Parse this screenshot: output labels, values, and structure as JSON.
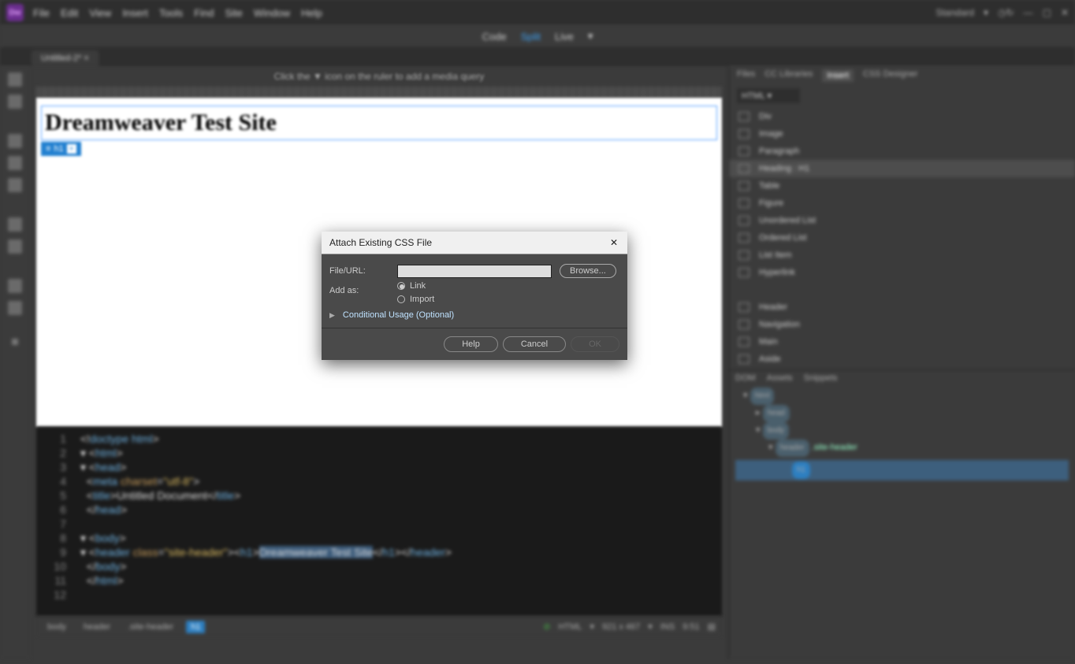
{
  "menubar": [
    "File",
    "Edit",
    "View",
    "Insert",
    "Tools",
    "Find",
    "Site",
    "Window",
    "Help"
  ],
  "workspace": "Standard",
  "view_tabs": {
    "code": "Code",
    "split": "Split",
    "live": "Live"
  },
  "doc_tab": "Untitled-2*",
  "hint": "Click the ▼ icon on the ruler to add a media query",
  "design": {
    "h1": "Dreamweaver Test Site",
    "chip": "h1",
    "plus": "+"
  },
  "code_lines": [
    {
      "n": "1",
      "raw": "<!doctype html>"
    },
    {
      "n": "2",
      "raw": "<html>"
    },
    {
      "n": "3",
      "raw": "<head>"
    },
    {
      "n": "4",
      "raw": "<meta charset=\"utf-8\">"
    },
    {
      "n": "5",
      "raw": "<title>Untitled Document</title>"
    },
    {
      "n": "6",
      "raw": "</head>"
    },
    {
      "n": "7",
      "raw": ""
    },
    {
      "n": "8",
      "raw": "<body>"
    },
    {
      "n": "9",
      "raw": "<header class=\"site-header\"><h1>Dreamweaver Test Site</h1></header>"
    },
    {
      "n": "10",
      "raw": "</body>"
    },
    {
      "n": "11",
      "raw": "</html>"
    },
    {
      "n": "12",
      "raw": ""
    }
  ],
  "status": {
    "breadcrumbs": [
      "body",
      "header",
      ".site-header",
      "h1"
    ],
    "doctype": "HTML",
    "dims": "921 x 467",
    "ins": "INS",
    "pos": "9:51"
  },
  "right": {
    "tabs": [
      "Files",
      "CC Libraries",
      "Insert",
      "CSS Designer"
    ],
    "active_tab": "Insert",
    "dd": "HTML",
    "items": [
      "Div",
      "Image",
      "Paragraph",
      "Heading : H1",
      "Table",
      "Figure",
      "Unordered List",
      "Ordered List",
      "List Item",
      "Hyperlink"
    ],
    "items2": [
      "Header",
      "Navigation",
      "Main",
      "Aside"
    ]
  },
  "dom": {
    "tabs": [
      "DOM",
      "Assets",
      "Snippets"
    ],
    "nodes": {
      "root": "html",
      "head": "head",
      "body": "body",
      "header": "header",
      "cls": ".site-header",
      "h1": "h1"
    }
  },
  "modal": {
    "title": "Attach Existing CSS File",
    "file_label": "File/URL:",
    "file_value": "",
    "browse": "Browse...",
    "add_as": "Add as:",
    "opt_link": "Link",
    "opt_import": "Import",
    "conditional": "Conditional Usage (Optional)",
    "help": "Help",
    "cancel": "Cancel",
    "ok": "OK"
  }
}
